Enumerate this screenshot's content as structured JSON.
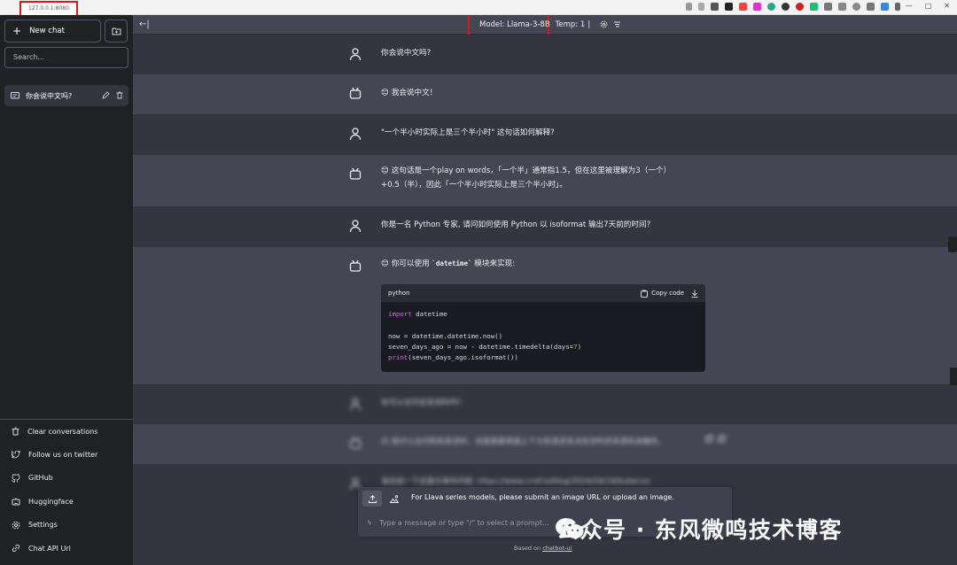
{
  "browser": {
    "url": "127.0.0.1:8080"
  },
  "sidebar": {
    "new_chat": "New chat",
    "search_placeholder": "Search...",
    "conversation": "你会说中文吗?",
    "bottom_items": [
      {
        "label": "Clear conversations",
        "icon": "trash-icon"
      },
      {
        "label": "Follow us on twitter",
        "icon": "twitter-icon"
      },
      {
        "label": "GitHub",
        "icon": "github-icon"
      },
      {
        "label": "Huggingface",
        "icon": "robot-icon"
      },
      {
        "label": "Settings",
        "icon": "gear-icon"
      },
      {
        "label": "Chat API Url",
        "icon": "link-icon"
      }
    ]
  },
  "topbar": {
    "model": "Model: Llama-3-8B",
    "temp": "Temp: 1",
    "separator": "|"
  },
  "messages": [
    {
      "role": "user",
      "text": "你会说中文吗?"
    },
    {
      "role": "bot",
      "text": "😊 我会说中文！"
    },
    {
      "role": "user",
      "text": "\"一个半小时实际上是三个半小时\" 这句话如何解释?"
    },
    {
      "role": "bot",
      "line1": "😊 这句话是一个play on words，「一个半」通常指1.5，但在这里被理解为3（一个）",
      "line2": "+0.5（半），因此「一个半小时实际上是三个半小时」。"
    },
    {
      "role": "user",
      "text": "你是一名 Python 专家, 请问如何使用 Python 以 isoformat 输出7天前的时间?"
    },
    {
      "role": "bot",
      "intro_prefix": "😊 你可以使用 ",
      "intro_code": "`datetime`",
      "intro_suffix": " 模块来实现:"
    },
    {
      "role": "user",
      "text": "你可以访问这些资料吗?"
    },
    {
      "role": "bot",
      "text": "😊 我可以访问和检索资料，但我需要根据上下文和请求来决定资料的来源和准确性。"
    },
    {
      "role": "user",
      "text": "请总结一下这篇文章的内容: https://www.cnxf.io/blog/2024/04/18/kubecon"
    }
  ],
  "code": {
    "lang": "python",
    "copy_label": "Copy code",
    "lines": [
      {
        "kw": "import",
        "rest": " datetime"
      },
      {
        "rest": ""
      },
      {
        "rest": "now = datetime.datetime.now()"
      },
      {
        "pre": "seven_days_ago = now - datetime.timedelta(days=",
        "num": "7",
        "post": ")"
      },
      {
        "kw": "print",
        "rest": "(seven_days_ago.isoformat())"
      }
    ]
  },
  "input": {
    "llava_hint": "For Llava series models, please submit an image URL or upload an image.",
    "placeholder": "Type a message or type \"/\" to select a prompt...",
    "footer_prefix": "Based on ",
    "footer_link": "chatbot-ui"
  },
  "watermark": "公众号 · 东风微鸣技术博客",
  "colors": {
    "accent_red": "#e01616",
    "sidebar_bg": "#202123",
    "bot_bg": "#444654",
    "user_bg": "#343541"
  }
}
